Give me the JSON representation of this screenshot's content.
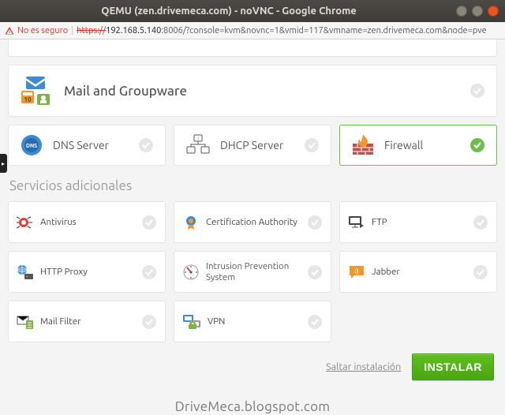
{
  "window": {
    "title": "QEMU (zen.drivemeca.com) - noVNC - Google Chrome"
  },
  "addressbar": {
    "warning_label": "No es seguro",
    "url_scheme": "https://",
    "url_host": "192.168.5.140",
    "url_rest": ":8006/?console=kvm&novnc=1&vmid=117&vmname=zen.drivemeca.com&node=pve"
  },
  "main_services": {
    "mail": {
      "label": "Mail and Groupware",
      "selected": false
    },
    "dns": {
      "label": "DNS Server",
      "selected": false
    },
    "dhcp": {
      "label": "DHCP Server",
      "selected": false
    },
    "firewall": {
      "label": "Firewall",
      "selected": true
    }
  },
  "additional": {
    "title": "Servicios adicionales",
    "items": [
      {
        "id": "antivirus",
        "label": "Antivirus",
        "selected": false
      },
      {
        "id": "ca",
        "label": "Certification Authority",
        "selected": false
      },
      {
        "id": "ftp",
        "label": "FTP",
        "selected": false
      },
      {
        "id": "httpproxy",
        "label": "HTTP Proxy",
        "selected": false
      },
      {
        "id": "ips",
        "label_line1": "Intrusion Prevention",
        "label_line2": "System",
        "selected": false
      },
      {
        "id": "jabber",
        "label": "Jabber",
        "selected": false
      },
      {
        "id": "mailfilter",
        "label": "Mail Filter",
        "selected": false
      },
      {
        "id": "vpn",
        "label": "VPN",
        "selected": false
      }
    ]
  },
  "footer": {
    "skip": "Saltar instalación",
    "install": "INSTALAR"
  },
  "watermark": "DriveMeca.blogspot.com"
}
